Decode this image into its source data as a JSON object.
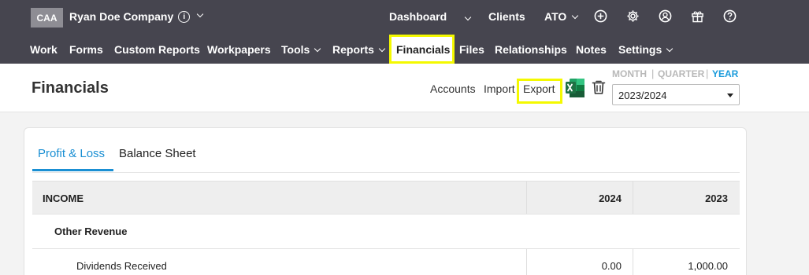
{
  "topbar": {
    "logo": "CAA",
    "company_name": "Ryan Doe Company",
    "dashboard": "Dashboard",
    "clients": "Clients",
    "ato": "ATO"
  },
  "nav": {
    "items": [
      "Work",
      "Forms",
      "Custom Reports",
      "Workpapers",
      "Tools",
      "Reports",
      "Financials",
      "Files",
      "Relationships",
      "Notes",
      "Settings"
    ],
    "active": "Financials"
  },
  "header": {
    "title": "Financials",
    "accounts": "Accounts",
    "import": "Import",
    "export": "Export",
    "period_month": "MONTH",
    "period_quarter": "QUARTER",
    "period_year": "YEAR",
    "period_active": "YEAR",
    "fiscal_year": "2023/2024"
  },
  "tabs": {
    "profit_loss": "Profit & Loss",
    "balance_sheet": "Balance Sheet",
    "active": "Profit & Loss"
  },
  "table": {
    "header": {
      "label": "INCOME",
      "col1": "2024",
      "col2": "2023"
    },
    "section": "Other Revenue",
    "rows": [
      {
        "label": "Dividends Received",
        "col1": "0.00",
        "col2": "1,000.00"
      }
    ]
  },
  "colors": {
    "topbar_bg": "#46454f",
    "accent_blue": "#1a8fd3",
    "highlight": "#f4f900",
    "excel_green": "#1f7244"
  }
}
